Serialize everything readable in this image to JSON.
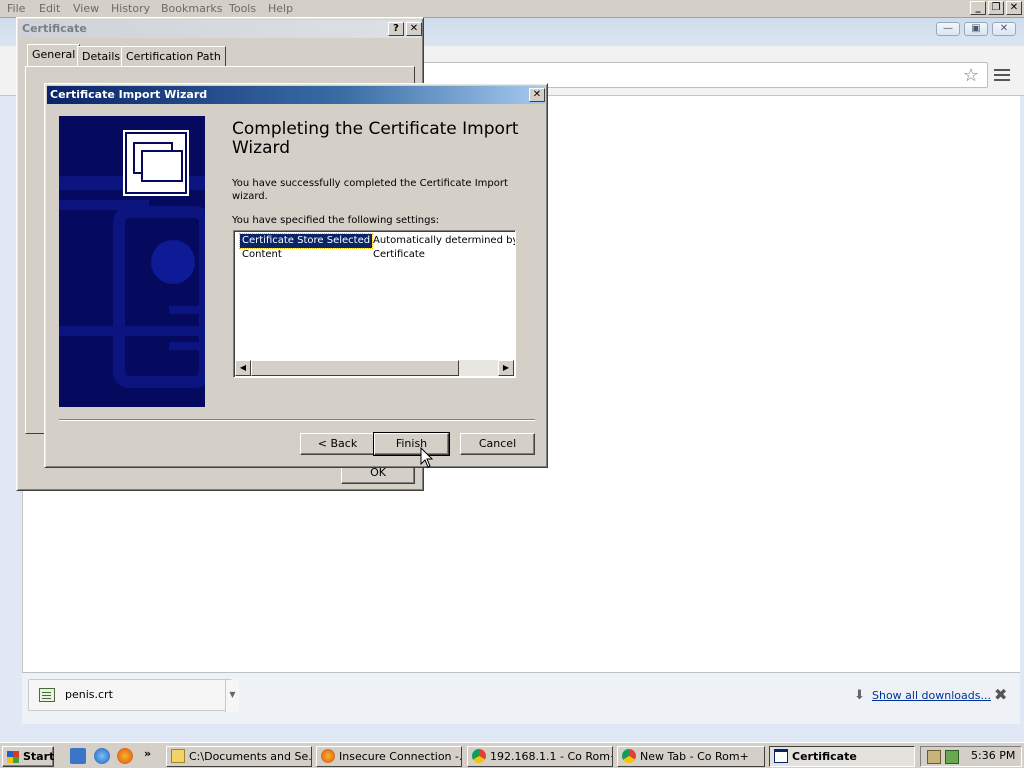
{
  "firefox_menu": [
    "File",
    "Edit",
    "View",
    "History",
    "Bookmarks",
    "Tools",
    "Help"
  ],
  "certificate_dialog": {
    "title": "Certificate",
    "tabs": [
      "General",
      "Details",
      "Certification Path"
    ],
    "ok_label": "OK"
  },
  "wizard": {
    "title": "Certificate Import Wizard",
    "heading_line1": "Completing the Certificate Import",
    "heading_line2": "Wizard",
    "success_text": "You have successfully completed the Certificate Import wizard.",
    "settings_label": "You have specified the following settings:",
    "settings": [
      {
        "name": "Certificate Store Selected",
        "value": "Automatically determined by t"
      },
      {
        "name": "Content",
        "value": "Certificate"
      }
    ],
    "back_label": "< Back",
    "finish_label": "Finish",
    "cancel_label": "Cancel"
  },
  "downloads": {
    "file_name": "penis.crt",
    "show_all_label": "Show all downloads..."
  },
  "taskbar": {
    "start_label": "Start",
    "tasks": [
      {
        "label": "C:\\Documents and Se...",
        "icon": "folder-icon"
      },
      {
        "label": "Insecure Connection -...",
        "icon": "firefox-icon"
      },
      {
        "label": "192.168.1.1 - Co Rom+",
        "icon": "chrome-icon"
      },
      {
        "label": "New Tab - Co Rom+",
        "icon": "chrome-icon"
      },
      {
        "label": "Certificate",
        "icon": "certificate-window-icon"
      }
    ],
    "clock": "5:36 PM"
  },
  "colors": {
    "title_active": "#0a246a",
    "dialog_face": "#d4d0c8",
    "wizard_banner": "#050a5e"
  }
}
